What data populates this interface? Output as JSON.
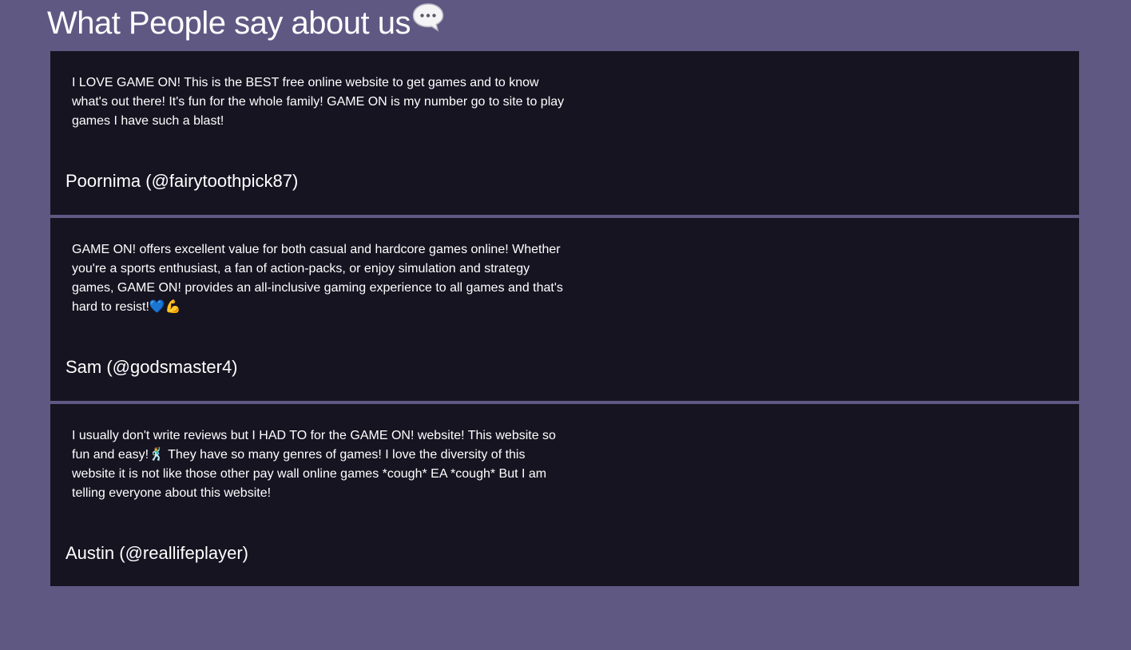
{
  "header": {
    "title": "What People say about us",
    "title_icon": "speech-balloon-icon"
  },
  "reviews": [
    {
      "text": "I LOVE GAME ON! This is the BEST free online website to get games and to know what's out there! It's fun for the whole family! GAME ON is my number go to site to play games I have such a blast!",
      "author": "Poornima (@fairytoothpick87)"
    },
    {
      "text": "GAME ON! offers excellent value for both casual and hardcore games online! Whether you're a sports enthusiast, a fan of action-packs, or enjoy simulation and strategy games, GAME ON! provides an all-inclusive gaming experience to all games and that's hard to resist!💙💪",
      "author": "Sam (@godsmaster4)"
    },
    {
      "text": "I usually don't write reviews but I HAD TO for the GAME ON! website! This website so fun and easy!🕺 They have so many genres of games! I love the diversity of this website it is not like those other pay wall online games *cough* EA *cough* But I am telling everyone about this website!",
      "author": "Austin (@reallifeplayer)"
    }
  ],
  "colors": {
    "page_background": "#5f5883",
    "card_background": "#161421",
    "text": "#ffffff"
  }
}
